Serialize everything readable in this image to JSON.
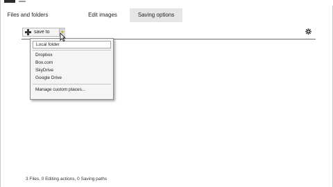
{
  "tabs": [
    {
      "label": "Files and folders"
    },
    {
      "label": "Edit images"
    },
    {
      "label": "Saving options"
    }
  ],
  "toolbar": {
    "save_to_label": "save to"
  },
  "menu": {
    "items": [
      {
        "label": "Local folder"
      },
      {
        "label": "Dropbox"
      },
      {
        "label": "Box.com"
      },
      {
        "label": "SkyDrive"
      },
      {
        "label": "Google Drive"
      },
      {
        "label": "Manage custom places..."
      }
    ]
  },
  "status": {
    "text": "3 Files, 0 Editing actions, 0 Saving paths"
  },
  "colors": {
    "active_tab_bg": "#e6e6e6",
    "dropdown_arrow": "#c9a300"
  }
}
